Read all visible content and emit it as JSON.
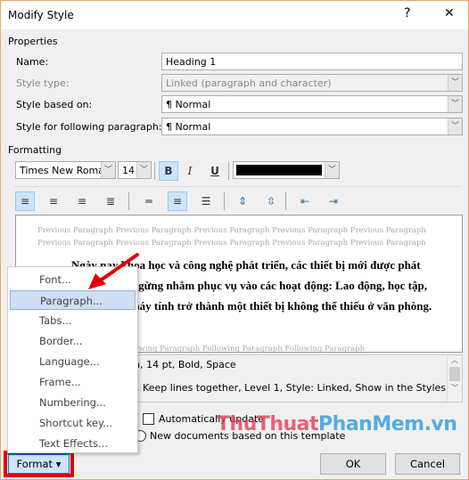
{
  "title": "Modify Style",
  "titlebar": {
    "help": "?",
    "close": "✕"
  },
  "properties": {
    "heading": "Properties",
    "name_label": "Name:",
    "name_value": "Heading 1",
    "style_type_label": "Style type:",
    "style_type_value": "Linked (paragraph and character)",
    "based_on_label": "Style based on:",
    "based_on_value": "¶  Normal",
    "following_label": "Style for following paragraph:",
    "following_value": "¶  Normal"
  },
  "formatting": {
    "heading": "Formatting",
    "font": "Times New Roman",
    "size": "14",
    "bold": "B",
    "italic": "I",
    "underline": "U",
    "color": "#000000"
  },
  "preview": {
    "previous": "Previous Paragraph Previous Paragraph Previous Paragraph Previous Paragraph Previous Paragraph Previous Paragraph Previous Paragraph Previous Paragraph Previous Paragraph Previous Paragraph",
    "text": "Ngày nay khoa học và công nghệ phát triển, các thiết bị mới được phát triển không ngừng nhằm phục vụ vào các hoạt động: Lao động, học tập, giải trí.. Và máy tính trở thành một thiết bị không thể thiếu ở văn phòng.",
    "following": "Following Paragraph Following Paragraph Following Paragraph Following Paragraph"
  },
  "description": {
    "line1": "Font: Times New Roman, 14 pt, Bold, Space",
    "line2": "Before: 12 pt, After: 0 pt, Keep with next, Keep lines together, Level 1, Style: Linked, Show in the Styles"
  },
  "options": {
    "auto_update": "Automatically update",
    "new_docs": "New documents based on this template"
  },
  "menu": [
    "Font...",
    "Paragraph...",
    "Tabs...",
    "Border...",
    "Language...",
    "Frame...",
    "Numbering...",
    "Shortcut key...",
    "Text Effects..."
  ],
  "buttons": {
    "format": "Format ▾",
    "ok": "OK",
    "cancel": "Cancel"
  },
  "watermark": {
    "part1": "ThuThuat",
    "part2": "PhanMem.vn"
  },
  "colors": {
    "highlight": "#e00000",
    "accent": "#cce4f7"
  }
}
